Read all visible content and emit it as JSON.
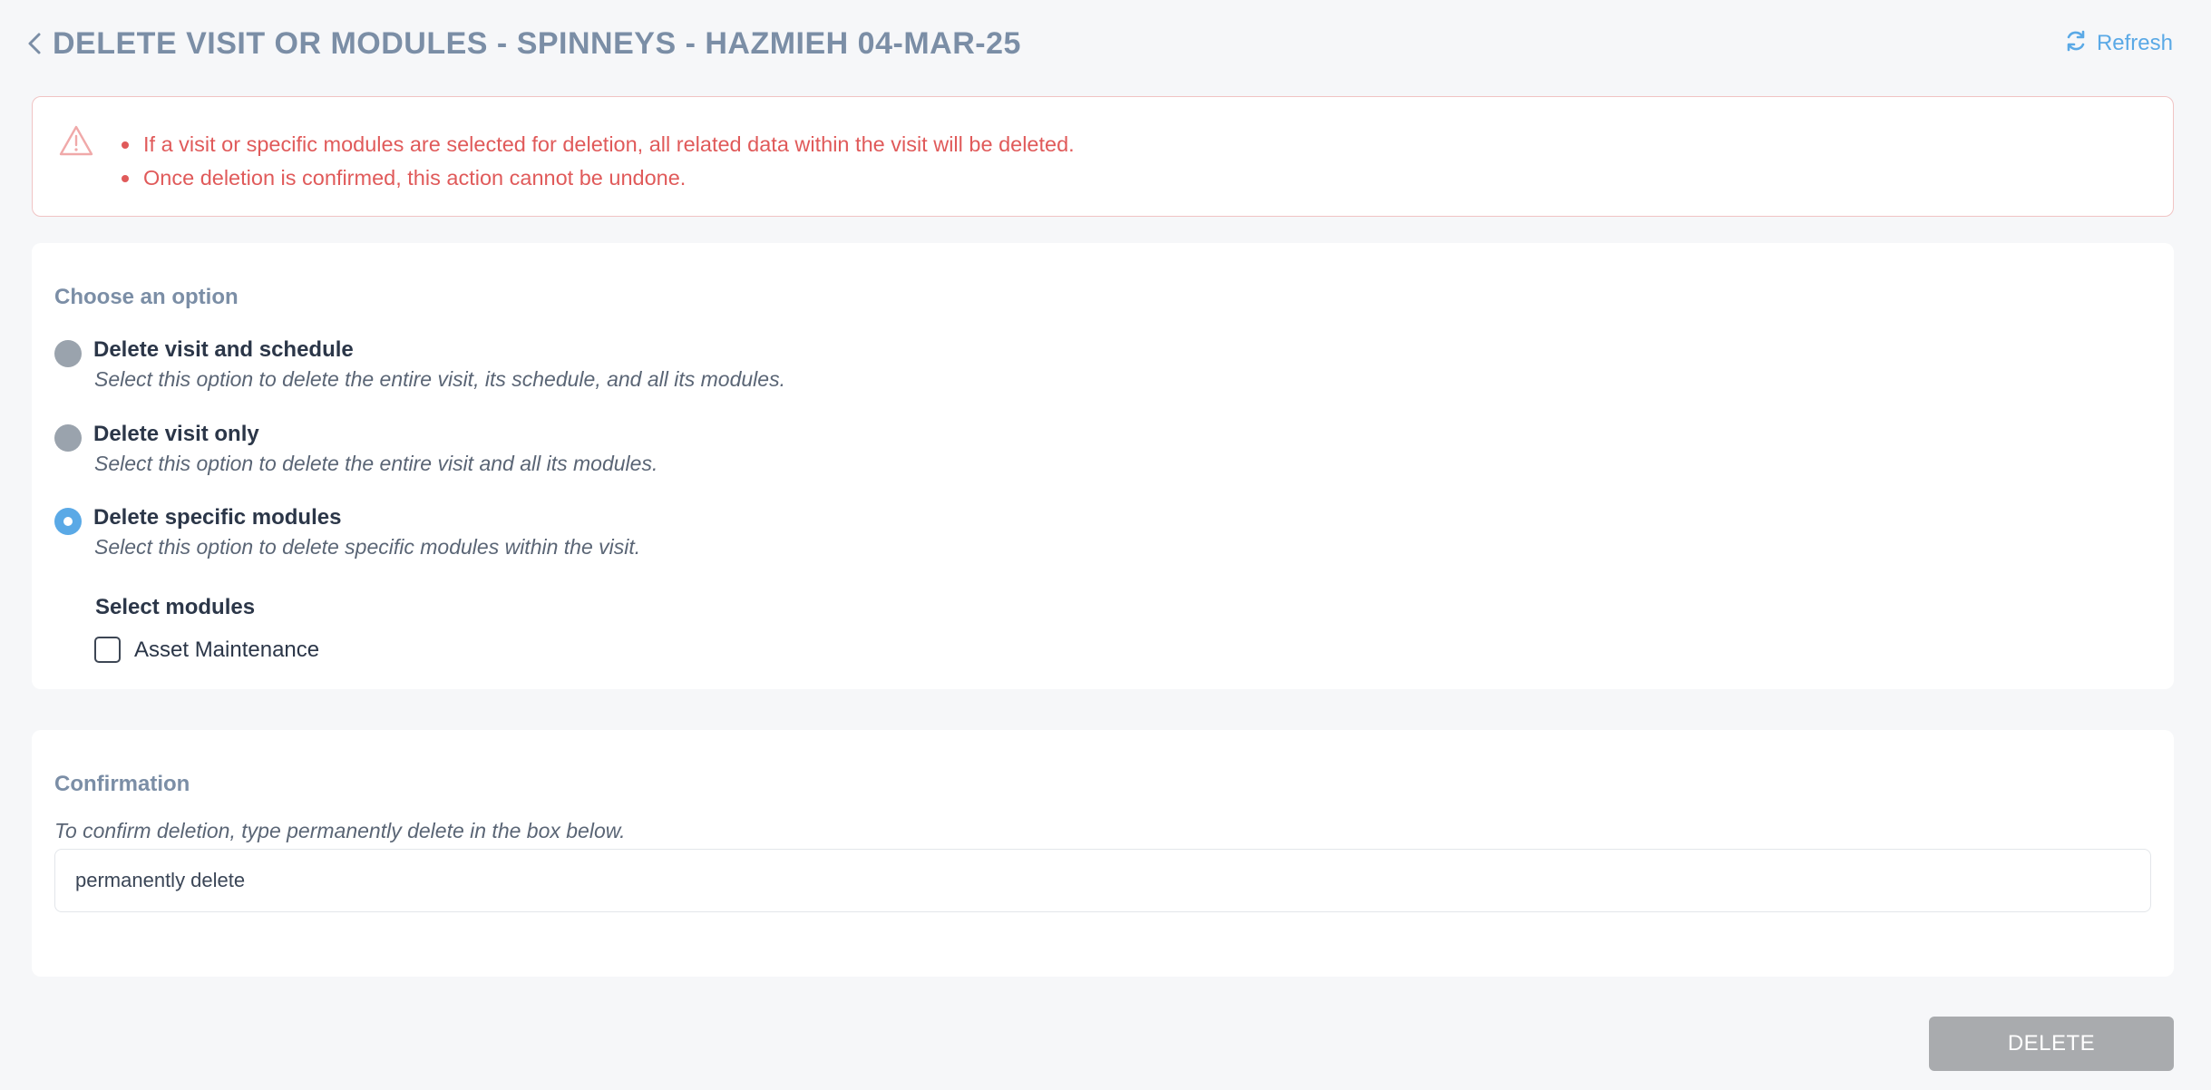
{
  "header": {
    "title": "DELETE VISIT OR MODULES - SPINNEYS - HAZMIEH 04-MAR-25",
    "refresh_label": "Refresh"
  },
  "warning": {
    "items": [
      "If a visit or specific modules are selected for deletion, all related data within the visit will be deleted.",
      "Once deletion is confirmed, this action cannot be undone."
    ]
  },
  "options": {
    "section_label": "Choose an option",
    "items": [
      {
        "title": "Delete visit and schedule",
        "description": "Select this option to delete the entire visit, its schedule, and all its modules.",
        "selected": false
      },
      {
        "title": "Delete visit only",
        "description": "Select this option to delete the entire visit and all its modules.",
        "selected": false
      },
      {
        "title": "Delete specific modules",
        "description": "Select this option to delete specific modules within the visit.",
        "selected": true
      }
    ],
    "modules_label": "Select modules",
    "modules": [
      {
        "label": "Asset Maintenance",
        "checked": false
      }
    ]
  },
  "confirmation": {
    "section_label": "Confirmation",
    "description": "To confirm deletion, type permanently delete in the box below.",
    "input_value": "permanently delete"
  },
  "actions": {
    "delete_label": "DELETE"
  },
  "colors": {
    "accent": "#5aa9e6",
    "warning": "#e05a5a",
    "label": "#7b8ea6",
    "disabled_button": "#a9abae"
  }
}
